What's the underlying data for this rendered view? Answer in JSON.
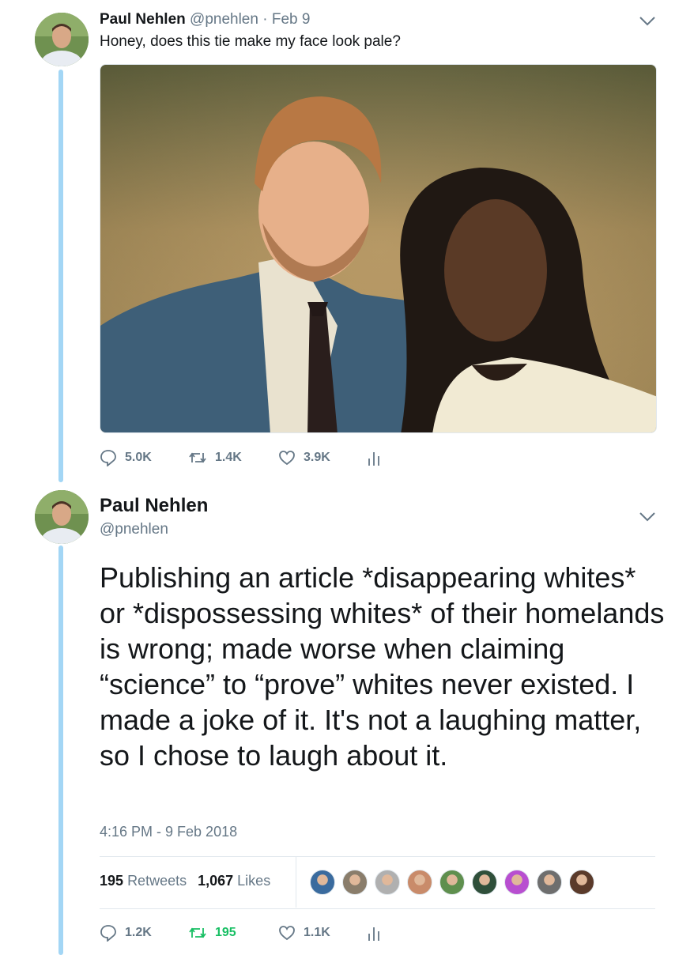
{
  "tweet1": {
    "name": "Paul Nehlen",
    "handle": "@pnehlen",
    "date": "Feb 9",
    "separator": " · ",
    "text": "Honey, does this tie make my face look pale?",
    "actions": {
      "replies": "5.0K",
      "retweets": "1.4K",
      "likes": "3.9K"
    }
  },
  "tweet2": {
    "name": "Paul Nehlen",
    "handle": "@pnehlen",
    "body": "Publishing an article *disappearing whites* or *dispossessing whites* of their homelands is wrong; made worse when claiming “science” to “prove” whites never existed. I made a joke of it. It's not a laughing matter, so I chose to laugh about it.",
    "timestamp": "4:16 PM - 9 Feb 2018",
    "retweet_count": "195",
    "retweet_label": "Retweets",
    "like_count": "1,067",
    "like_label": "Likes",
    "actions": {
      "replies": "1.2K",
      "retweets": "195",
      "likes": "1.1K"
    }
  },
  "likers": [
    "#3a6b9e",
    "#8a7d6b",
    "#b0b0b0",
    "#c98b6a",
    "#5f8f4e",
    "#2f4f3a",
    "#b84fd0",
    "#6e6e6e",
    "#5a3a2a"
  ],
  "colors": {
    "accent": "#1da1f2",
    "thread_line": "#a3d6f5",
    "retweet_green": "#17bf63",
    "muted": "#657786"
  },
  "icons": [
    "chevron-down-icon",
    "reply-icon",
    "retweet-icon",
    "like-icon",
    "analytics-icon"
  ]
}
